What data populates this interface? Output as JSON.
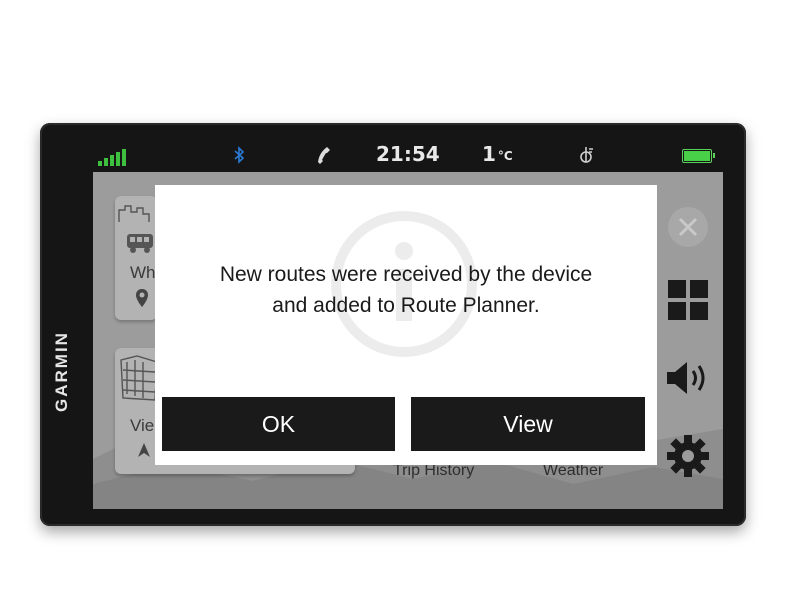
{
  "device": {
    "brand": "GARMIN"
  },
  "status_bar": {
    "time": "21:54",
    "temperature": "1",
    "temperature_unit": "°C",
    "icons": [
      "signal-bars-icon",
      "bluetooth-icon",
      "phone-icon",
      "traffic-icon",
      "battery-icon"
    ],
    "colors": {
      "signal": "#3fbf3f",
      "bluetooth": "#2b7bd6",
      "battery": "#48d148"
    }
  },
  "background_screen": {
    "tiles": [
      {
        "label": "Wh",
        "icon": "map-pin-icon"
      },
      {
        "label": "Vie",
        "icon": "navigation-arrow-icon"
      }
    ],
    "labels": {
      "trip_history": "Trip History",
      "weather": "Weather"
    },
    "side_icons": [
      "close-icon",
      "apps-grid-icon",
      "volume-icon",
      "settings-gear-icon"
    ]
  },
  "dialog": {
    "message_line1": "New routes were received by the device",
    "message_line2": "and added to Route Planner.",
    "buttons": {
      "ok": "OK",
      "view": "View"
    },
    "icon": "info-watermark-icon"
  }
}
